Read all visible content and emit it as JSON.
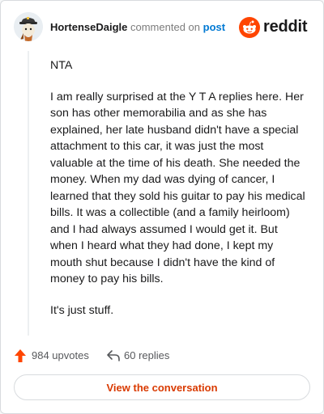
{
  "header": {
    "username": "HortenseDaigle",
    "action_text": "commented on",
    "post_link": "post",
    "brand": "reddit"
  },
  "comment": {
    "paragraphs": [
      "NTA",
      "I am really surprised at the Y T A replies here. Her son has other memorabilia and as she has explained, her late husband didn't have a special attachment to this car, it was just the most valuable at the time of his death. She needed the money. When my dad was dying of cancer, I learned that they sold his guitar to pay his medical bills. It was a collectible (and a family heirloom) and I had always assumed I would get it. But when I heard what they had done, I kept my mouth shut because I didn't have the kind of money to pay his bills.",
      "It's just stuff."
    ]
  },
  "actions": {
    "upvotes": "984 upvotes",
    "replies": "60 replies"
  },
  "cta": {
    "label": "View the conversation"
  },
  "colors": {
    "brand_orange": "#ff4500",
    "link_blue": "#0079d3",
    "cta_text": "#d93a00"
  },
  "icons": {
    "avatar": "avatar-icon",
    "brand": "reddit-logo-icon",
    "upvote": "upvote-arrow-icon",
    "reply": "reply-arrow-icon"
  }
}
